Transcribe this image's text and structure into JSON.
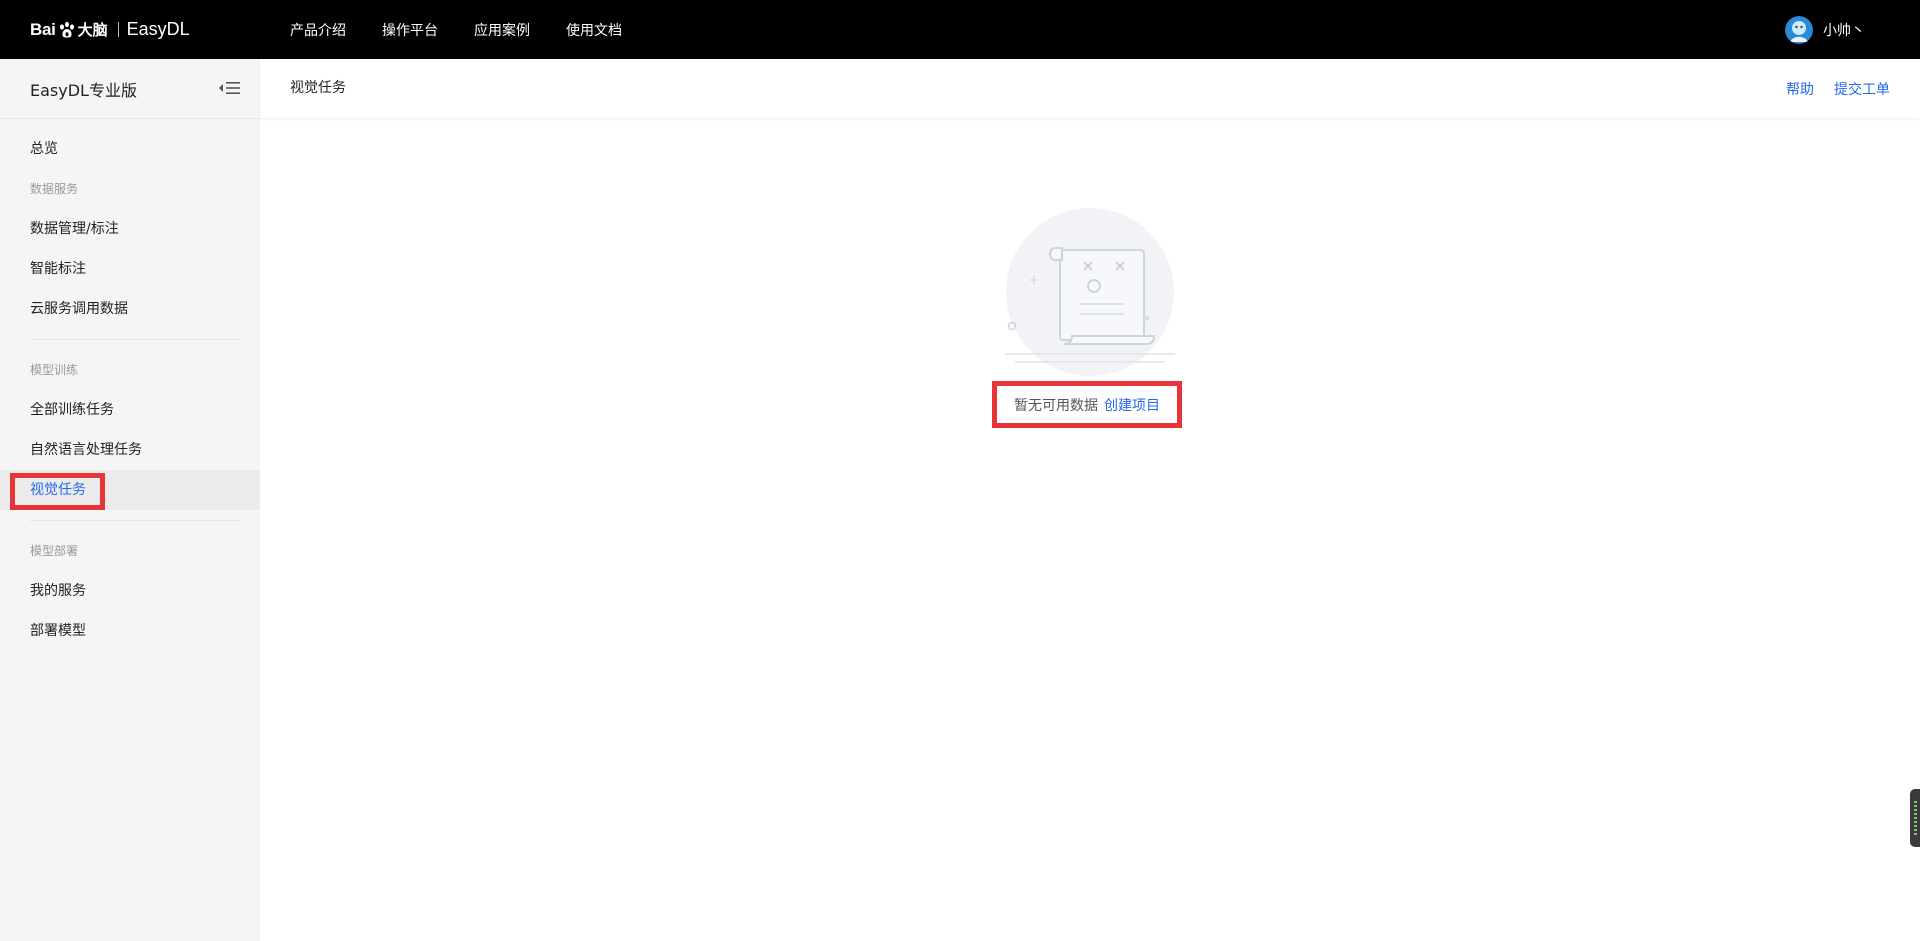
{
  "brand": {
    "logo_bai": "Bai",
    "logo_danao": "大脑",
    "product": "EasyDL"
  },
  "topnav": {
    "items": [
      {
        "label": "产品介绍"
      },
      {
        "label": "操作平台"
      },
      {
        "label": "应用案例"
      },
      {
        "label": "使用文档"
      }
    ]
  },
  "user": {
    "name": "小帅丶"
  },
  "sidebar": {
    "title": "EasyDL专业版",
    "toggle_icon": "collapse-menu-icon",
    "items": [
      {
        "type": "item",
        "label": "总览"
      },
      {
        "type": "group",
        "label": "数据服务"
      },
      {
        "type": "item",
        "label": "数据管理/标注"
      },
      {
        "type": "item",
        "label": "智能标注"
      },
      {
        "type": "item",
        "label": "云服务调用数据"
      },
      {
        "type": "group",
        "label": "模型训练"
      },
      {
        "type": "item",
        "label": "全部训练任务"
      },
      {
        "type": "item",
        "label": "自然语言处理任务"
      },
      {
        "type": "item",
        "label": "视觉任务",
        "active": true
      },
      {
        "type": "group",
        "label": "模型部署"
      },
      {
        "type": "item",
        "label": "我的服务"
      },
      {
        "type": "item",
        "label": "部署模型"
      }
    ]
  },
  "page": {
    "title": "视觉任务",
    "help_link": "帮助",
    "ticket_link": "提交工单"
  },
  "empty_state": {
    "message": "暂无可用数据",
    "action": "创建项目",
    "icon": "empty-document-icon"
  },
  "colors": {
    "topbar_bg": "#000000",
    "accent": "#2468f2",
    "highlight": "#e8333a",
    "sidebar_bg": "#f5f5f5"
  }
}
